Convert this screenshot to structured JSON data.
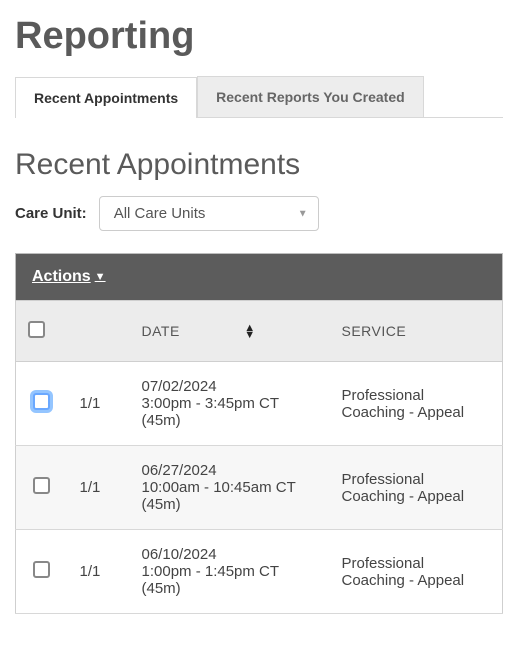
{
  "page_title": "Reporting",
  "tabs": [
    {
      "label": "Recent Appointments",
      "active": true
    },
    {
      "label": "Recent Reports You Created",
      "active": false
    }
  ],
  "section_title": "Recent Appointments",
  "filter": {
    "label": "Care Unit:",
    "selected": "All Care Units"
  },
  "actions_label": "Actions",
  "columns": {
    "date": "DATE",
    "service": "SERVICE"
  },
  "rows": [
    {
      "count": "1/1",
      "date": "07/02/2024",
      "time": "3:00pm - 3:45pm CT",
      "duration": "(45m)",
      "service": "Professional Coaching - Appeal",
      "checkbox_focused": true
    },
    {
      "count": "1/1",
      "date": "06/27/2024",
      "time": "10:00am - 10:45am CT",
      "duration": "(45m)",
      "service": "Professional Coaching - Appeal",
      "checkbox_focused": false
    },
    {
      "count": "1/1",
      "date": "06/10/2024",
      "time": "1:00pm - 1:45pm CT",
      "duration": "(45m)",
      "service": "Professional Coaching - Appeal",
      "checkbox_focused": false
    }
  ]
}
